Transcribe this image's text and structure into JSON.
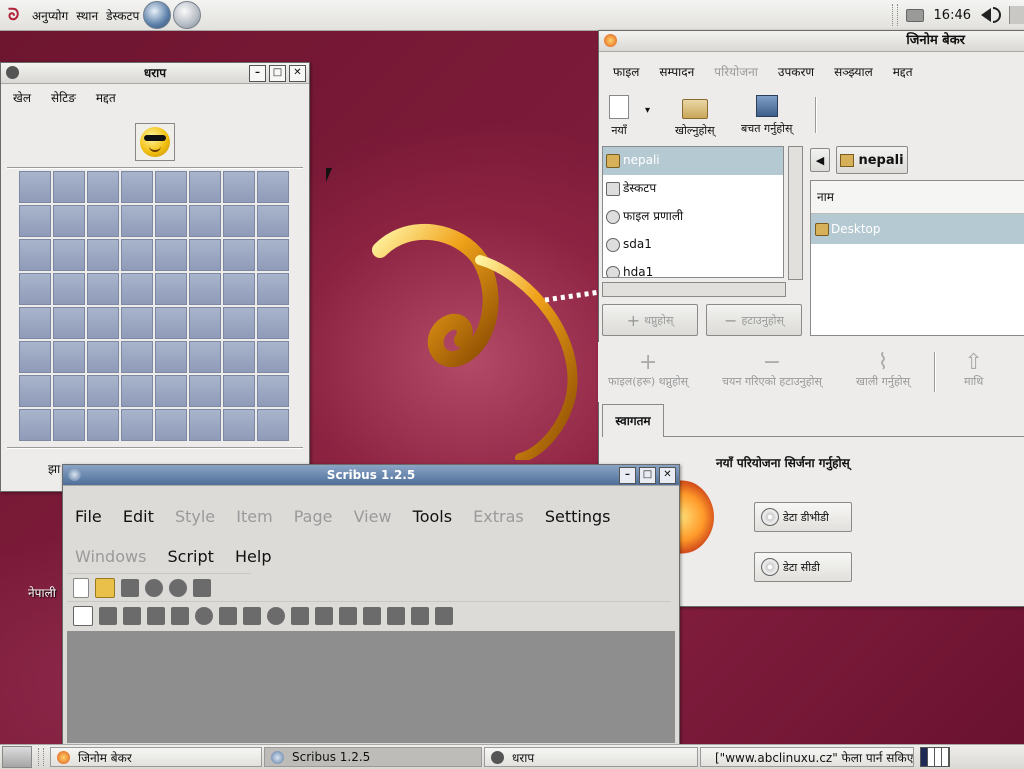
{
  "top_panel": {
    "menus": [
      "अनुप्योग",
      "स्थान",
      "डेस्कटप"
    ],
    "clock": "16:46"
  },
  "minesweeper": {
    "title": "धराप",
    "menu": [
      "खेल",
      "सेटिङ",
      "मद्दत"
    ],
    "grid_rows": 8,
    "grid_cols": 8,
    "footer_text": "झा"
  },
  "baker": {
    "title": "जिनोम बेकर",
    "menu": [
      {
        "label": "फाइल",
        "enabled": true
      },
      {
        "label": "सम्पादन",
        "enabled": true
      },
      {
        "label": "परियोजना",
        "enabled": false
      },
      {
        "label": "उपकरण",
        "enabled": true
      },
      {
        "label": "सञ्झ्याल",
        "enabled": true
      },
      {
        "label": "मद्दत",
        "enabled": true
      }
    ],
    "toolbar": {
      "new": "नयाँ",
      "open": "खोल्नुहोस्",
      "save": "बचत गर्नुहोस्"
    },
    "file_tree": [
      {
        "label": "nepali",
        "selected": true,
        "icon": "home-folder-icon"
      },
      {
        "label": "डेस्कटप",
        "selected": false,
        "icon": "desktop-icon"
      },
      {
        "label": "फाइल प्रणाली",
        "selected": false,
        "icon": "drive-icon"
      },
      {
        "label": "sda1",
        "selected": false,
        "icon": "drive-icon"
      },
      {
        "label": "hda1",
        "selected": false,
        "icon": "drive-icon"
      }
    ],
    "path_button": "nepali",
    "list_header": "नाम",
    "list_rows": [
      "Desktop"
    ],
    "add_button": "थप्नुहोस्",
    "remove_button": "हटाउनुहोस्",
    "actions": {
      "add_files": "फाइल(हरू) थप्नुहोस्",
      "remove_selected": "चयन गरिएको हटाउनुहोस्",
      "clear": "खाली गर्नुहोस्",
      "up": "माथि"
    },
    "tab_label": "स्वागतम",
    "welcome_text": "नयाँ परियोजना सिर्जना गर्नुहोस्",
    "data_cd_button": "डेटा डीभीडी",
    "data_cd_button2": "डेटा सीडी"
  },
  "scribus": {
    "title": "Scribus 1.2.5",
    "menu": [
      {
        "label": "File",
        "enabled": true
      },
      {
        "label": "Edit",
        "enabled": true
      },
      {
        "label": "Style",
        "enabled": false
      },
      {
        "label": "Item",
        "enabled": false
      },
      {
        "label": "Page",
        "enabled": false
      },
      {
        "label": "View",
        "enabled": false
      },
      {
        "label": "Tools",
        "enabled": true
      },
      {
        "label": "Extras",
        "enabled": false
      },
      {
        "label": "Settings",
        "enabled": true
      },
      {
        "label": "Windows",
        "enabled": false
      },
      {
        "label": "Script",
        "enabled": true
      },
      {
        "label": "Help",
        "enabled": true
      }
    ]
  },
  "desktop": {
    "icon_label": "नेपाली"
  },
  "bottom_panel": {
    "tasks": [
      {
        "label": "जिनोम बेकर",
        "active": false
      },
      {
        "label": "Scribus 1.2.5",
        "active": true
      },
      {
        "label": "धराप",
        "active": false
      },
      {
        "label": "[\"www.abclinuxu.cz\" फेला पार्न सकिएन",
        "active": false
      }
    ]
  },
  "colors": {
    "desktop_bg": "#7a1a35",
    "active_titlebar": "#4f6f99",
    "selection": "#b5c9d2",
    "mine_cell": "#97a3bf"
  }
}
